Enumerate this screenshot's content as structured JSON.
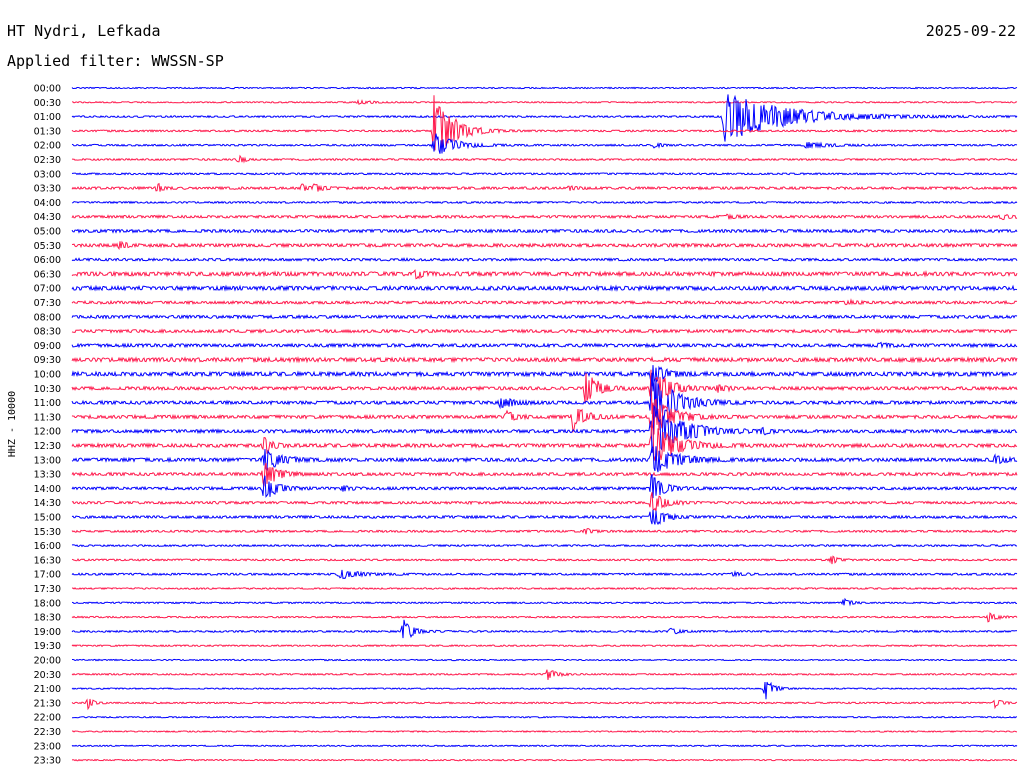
{
  "header": {
    "station": "HT Nydri, Lefkada",
    "date": "2025-09-22",
    "filter": "Applied filter: WWSSN-SP"
  },
  "chart_data": {
    "type": "helicorder",
    "ylabel": "HHZ - 10000",
    "x_range_minutes": [
      0,
      30
    ],
    "trace_colors": [
      "#0000ff",
      "#ff1a4d"
    ],
    "rows": [
      {
        "label": "00:00",
        "noise": 0.5,
        "events": []
      },
      {
        "label": "00:30",
        "noise": 0.5,
        "events": [
          {
            "t": 9.1,
            "amp": 2,
            "dur": 1.0
          }
        ]
      },
      {
        "label": "01:00",
        "noise": 0.7,
        "events": [
          {
            "t": 20.7,
            "amp": 26,
            "dur": 4.0
          }
        ]
      },
      {
        "label": "01:30",
        "noise": 0.7,
        "events": [
          {
            "t": 11.5,
            "amp": 40,
            "dur": 1.2
          }
        ]
      },
      {
        "label": "02:00",
        "noise": 0.7,
        "events": [
          {
            "t": 11.5,
            "amp": 12,
            "dur": 1.4
          },
          {
            "t": 18.5,
            "amp": 3,
            "dur": 0.4
          },
          {
            "t": 23.3,
            "amp": 3,
            "dur": 1.5
          }
        ]
      },
      {
        "label": "02:30",
        "noise": 0.7,
        "events": [
          {
            "t": 5.3,
            "amp": 4,
            "dur": 0.4
          }
        ]
      },
      {
        "label": "03:00",
        "noise": 0.7,
        "events": []
      },
      {
        "label": "03:30",
        "noise": 1.0,
        "events": [
          {
            "t": 2.7,
            "amp": 5,
            "dur": 0.4
          },
          {
            "t": 7.3,
            "amp": 4,
            "dur": 0.4
          },
          {
            "t": 7.7,
            "amp": 5,
            "dur": 0.5
          },
          {
            "t": 15.8,
            "amp": 3,
            "dur": 0.4
          }
        ]
      },
      {
        "label": "04:00",
        "noise": 0.7,
        "events": []
      },
      {
        "label": "04:30",
        "noise": 1.0,
        "events": [
          {
            "t": 20.8,
            "amp": 2,
            "dur": 0.8
          },
          {
            "t": 29.5,
            "amp": 3,
            "dur": 0.6
          }
        ]
      },
      {
        "label": "05:00",
        "noise": 1.2,
        "events": []
      },
      {
        "label": "05:30",
        "noise": 1.3,
        "events": [
          {
            "t": 1.5,
            "amp": 5,
            "dur": 0.4
          }
        ]
      },
      {
        "label": "06:00",
        "noise": 1.0,
        "events": []
      },
      {
        "label": "06:30",
        "noise": 1.6,
        "events": [
          {
            "t": 10.9,
            "amp": 5,
            "dur": 0.5
          }
        ]
      },
      {
        "label": "07:00",
        "noise": 1.6,
        "events": []
      },
      {
        "label": "07:30",
        "noise": 1.1,
        "events": [
          {
            "t": 24.6,
            "amp": 2,
            "dur": 0.8
          }
        ]
      },
      {
        "label": "08:00",
        "noise": 1.2,
        "events": []
      },
      {
        "label": "08:30",
        "noise": 1.2,
        "events": []
      },
      {
        "label": "09:00",
        "noise": 1.3,
        "events": [
          {
            "t": 25.6,
            "amp": 2,
            "dur": 0.8
          }
        ]
      },
      {
        "label": "09:30",
        "noise": 1.6,
        "events": []
      },
      {
        "label": "10:00",
        "noise": 1.6,
        "events": [
          {
            "t": 18.4,
            "amp": 12,
            "dur": 0.8
          }
        ]
      },
      {
        "label": "10:30",
        "noise": 1.3,
        "events": [
          {
            "t": 16.3,
            "amp": 18,
            "dur": 0.8
          },
          {
            "t": 18.4,
            "amp": 26,
            "dur": 1.0
          },
          {
            "t": 20.5,
            "amp": 4,
            "dur": 0.5
          }
        ]
      },
      {
        "label": "11:00",
        "noise": 1.3,
        "events": [
          {
            "t": 13.6,
            "amp": 5,
            "dur": 1.0
          },
          {
            "t": 18.4,
            "amp": 30,
            "dur": 1.5
          }
        ]
      },
      {
        "label": "11:30",
        "noise": 1.3,
        "events": [
          {
            "t": 13.8,
            "amp": 8,
            "dur": 0.5
          },
          {
            "t": 15.9,
            "amp": 14,
            "dur": 0.8
          },
          {
            "t": 18.4,
            "amp": 26,
            "dur": 1.2
          }
        ]
      },
      {
        "label": "12:00",
        "noise": 1.3,
        "events": [
          {
            "t": 18.4,
            "amp": 28,
            "dur": 2.0
          },
          {
            "t": 21.9,
            "amp": 4,
            "dur": 0.4
          }
        ]
      },
      {
        "label": "12:30",
        "noise": 1.4,
        "events": [
          {
            "t": 6.1,
            "amp": 10,
            "dur": 0.5
          },
          {
            "t": 18.4,
            "amp": 24,
            "dur": 1.5
          }
        ]
      },
      {
        "label": "13:00",
        "noise": 1.4,
        "events": [
          {
            "t": 6.1,
            "amp": 13,
            "dur": 1.0
          },
          {
            "t": 18.4,
            "amp": 16,
            "dur": 1.5
          },
          {
            "t": 29.3,
            "amp": 4,
            "dur": 0.8
          }
        ]
      },
      {
        "label": "13:30",
        "noise": 1.2,
        "events": [
          {
            "t": 6.1,
            "amp": 16,
            "dur": 0.8
          }
        ]
      },
      {
        "label": "14:00",
        "noise": 1.1,
        "events": [
          {
            "t": 6.1,
            "amp": 14,
            "dur": 0.8
          },
          {
            "t": 8.6,
            "amp": 3,
            "dur": 0.5
          },
          {
            "t": 18.4,
            "amp": 14,
            "dur": 0.8
          }
        ]
      },
      {
        "label": "14:30",
        "noise": 1.0,
        "events": [
          {
            "t": 18.4,
            "amp": 12,
            "dur": 0.8
          }
        ]
      },
      {
        "label": "15:00",
        "noise": 1.0,
        "events": [
          {
            "t": 18.4,
            "amp": 12,
            "dur": 0.8
          }
        ]
      },
      {
        "label": "15:30",
        "noise": 0.8,
        "events": [
          {
            "t": 16.3,
            "amp": 4,
            "dur": 0.4
          }
        ]
      },
      {
        "label": "16:00",
        "noise": 0.7,
        "events": []
      },
      {
        "label": "16:30",
        "noise": 0.7,
        "events": [
          {
            "t": 24.1,
            "amp": 5,
            "dur": 0.4
          }
        ]
      },
      {
        "label": "17:00",
        "noise": 0.8,
        "events": [
          {
            "t": 8.5,
            "amp": 5,
            "dur": 1.2
          },
          {
            "t": 21.0,
            "amp": 2,
            "dur": 0.6
          }
        ]
      },
      {
        "label": "17:30",
        "noise": 0.6,
        "events": []
      },
      {
        "label": "18:00",
        "noise": 0.6,
        "events": [
          {
            "t": 24.5,
            "amp": 5,
            "dur": 0.5
          }
        ]
      },
      {
        "label": "18:30",
        "noise": 0.6,
        "events": [
          {
            "t": 29.1,
            "amp": 6,
            "dur": 0.5
          }
        ]
      },
      {
        "label": "19:00",
        "noise": 0.7,
        "events": [
          {
            "t": 10.5,
            "amp": 13,
            "dur": 0.6
          },
          {
            "t": 19.0,
            "amp": 4,
            "dur": 0.5
          }
        ]
      },
      {
        "label": "19:30",
        "noise": 0.6,
        "events": []
      },
      {
        "label": "20:00",
        "noise": 0.5,
        "events": []
      },
      {
        "label": "20:30",
        "noise": 0.6,
        "events": [
          {
            "t": 15.1,
            "amp": 6,
            "dur": 0.6
          }
        ]
      },
      {
        "label": "21:00",
        "noise": 0.5,
        "events": [
          {
            "t": 22.0,
            "amp": 12,
            "dur": 0.5
          }
        ]
      },
      {
        "label": "21:30",
        "noise": 0.6,
        "events": [
          {
            "t": 0.5,
            "amp": 6,
            "dur": 0.4
          },
          {
            "t": 29.3,
            "amp": 5,
            "dur": 0.4
          }
        ]
      },
      {
        "label": "22:00",
        "noise": 0.5,
        "events": []
      },
      {
        "label": "22:30",
        "noise": 0.5,
        "events": []
      },
      {
        "label": "23:00",
        "noise": 0.5,
        "events": []
      },
      {
        "label": "23:30",
        "noise": 0.5,
        "events": []
      }
    ]
  }
}
